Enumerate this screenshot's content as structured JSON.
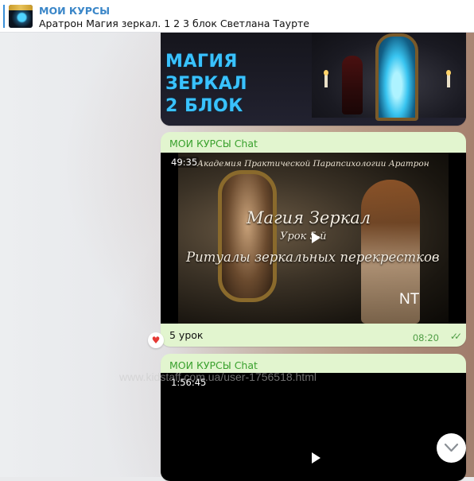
{
  "header": {
    "title": "МОИ КУРСЫ",
    "subtitle": "Аратрон Магия зеркал. 1 2 3 блок Светлана Таурте",
    "icon": "channel-avatar"
  },
  "messages": [
    {
      "type": "image",
      "poster_title_line1": "МАГИЯ ЗЕРКАЛ",
      "poster_title_line2": "2 БЛОК"
    },
    {
      "type": "video",
      "sender": "МОИ КУРСЫ Chat",
      "duration": "49:35",
      "video_header": "Академия Практической Парапсихологии Аратрон",
      "video_title": "Магия Зеркал",
      "video_lesson": "Урок 5-й",
      "video_subtitle": "Ритуалы зеркальных перекрестков",
      "video_mark": "NT",
      "caption": "5 урок",
      "time": "08:20",
      "status_icon": "double-check-icon",
      "reaction": "♥"
    },
    {
      "type": "video",
      "sender": "МОИ КУРСЫ Chat",
      "duration": "1:56:45"
    }
  ],
  "watermark": "www.kidstaff.com.ua/user-1756518.html",
  "colors": {
    "accent": "#3a86c8",
    "sender": "#3aa12e",
    "bubble": "#e2f5cf",
    "poster_title": "#39c2ff",
    "reaction": "#e53935"
  }
}
